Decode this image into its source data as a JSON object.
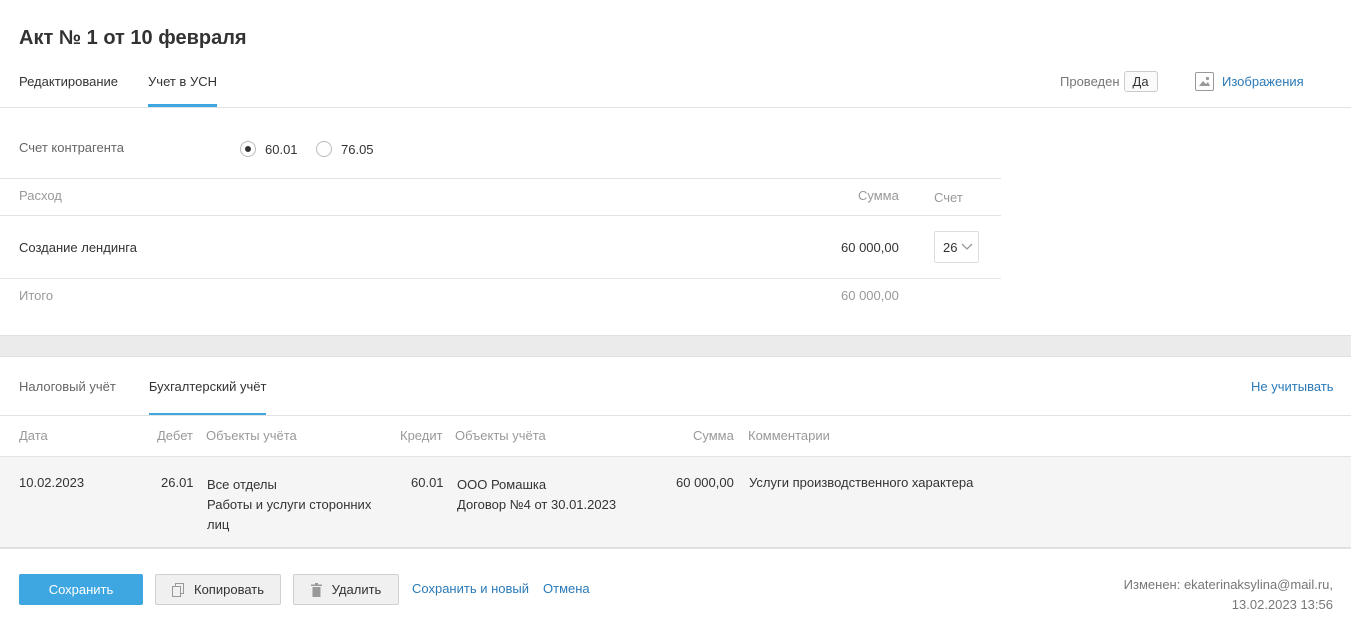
{
  "header": {
    "title": "Акт № 1 от 10 февраля",
    "tabs": [
      {
        "label": "Редактирование"
      },
      {
        "label": "Учет в УСН"
      }
    ],
    "posted_label": "Проведен",
    "posted_value": "Да",
    "images_link": "Изображения",
    "icons": {
      "images": "image-icon"
    }
  },
  "counterparty": {
    "label": "Счет контрагента",
    "options": [
      "60.01",
      "76.05"
    ],
    "selected": "60.01"
  },
  "expenses": {
    "columns": {
      "name": "Расход",
      "sum": "Сумма",
      "account": "Счет"
    },
    "rows": [
      {
        "name": "Создание лендинга",
        "sum": "60 000,00",
        "account": "26"
      }
    ],
    "total_label": "Итого",
    "total_sum": "60 000,00"
  },
  "accounting": {
    "tabs": [
      {
        "label": "Налоговый учёт"
      },
      {
        "label": "Бухгалтерский учёт"
      }
    ],
    "exclude_link": "Не учитывать",
    "columns": {
      "date": "Дата",
      "debit": "Дебет",
      "debit_objects": "Объекты учёта",
      "credit": "Кредит",
      "credit_objects": "Объекты учёта",
      "sum": "Сумма",
      "comments": "Комментарии"
    },
    "rows": [
      {
        "date": "10.02.2023",
        "debit": "26.01",
        "debit_objects": [
          "Все отделы",
          "Работы и услуги сторонних",
          "лиц"
        ],
        "credit": "60.01",
        "credit_objects": [
          "ООО Ромашка",
          "Договор №4 от 30.01.2023"
        ],
        "sum": "60 000,00",
        "comment": "Услуги производственного характера"
      }
    ]
  },
  "footer": {
    "save": "Сохранить",
    "copy": "Копировать",
    "delete": "Удалить",
    "save_new": "Сохранить и новый",
    "cancel": "Отмена",
    "modified_line1": "Изменен: ekaterinaksylina@mail.ru,",
    "modified_line2": "13.02.2023 13:56",
    "icons": {
      "copy": "copy-icon",
      "delete": "trash-icon"
    }
  },
  "colors": {
    "accent": "#3ea6e0",
    "link": "#2a7ab8"
  }
}
